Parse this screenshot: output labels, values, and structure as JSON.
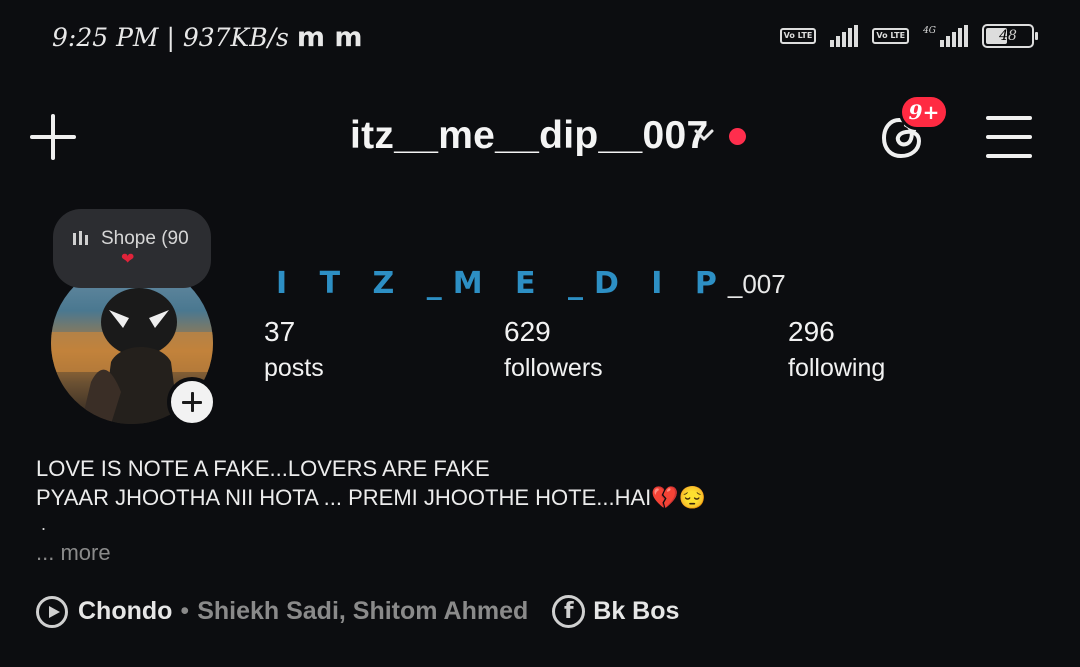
{
  "status_bar": {
    "time": "9:25 PM | 937KB/s",
    "notif_icons": "m m",
    "volte1": "Vo LTE",
    "volte2": "Vo LTE",
    "network": "4G",
    "battery": "48"
  },
  "header": {
    "username": "itz__me__dip__007",
    "notification_badge": "9+",
    "icons": {
      "add": "plus-icon",
      "switch": "chevron-down-icon",
      "threads": "threads-icon",
      "menu": "hamburger-menu-icon"
    },
    "accent_red": "#ff2e4d"
  },
  "note": {
    "text": "Shope (90",
    "heart": "❤"
  },
  "profile": {
    "display_name_styled": "I T Z _M E _D I P",
    "display_name_tail": "_007",
    "display_name_color": "#2d8fc4",
    "stats": [
      {
        "value": "37",
        "label": "posts"
      },
      {
        "value": "629",
        "label": "followers"
      },
      {
        "value": "296",
        "label": "following"
      }
    ],
    "bio_lines": [
      "LOVE IS NOTE A FAKE...LOVERS ARE FAKE",
      "PYAAR JHOOTHA NII HOTA ... PREMI JHOOTHE HOTE...HAI💔😔"
    ],
    "bio_dot": ".",
    "more_label": "... more",
    "music": {
      "song": "Chondo",
      "separator": "•",
      "artists": "Shiekh Sadi, Shitom Ahmed"
    },
    "facebook": {
      "icon_letter": "f",
      "name": "Bk Bos"
    }
  }
}
